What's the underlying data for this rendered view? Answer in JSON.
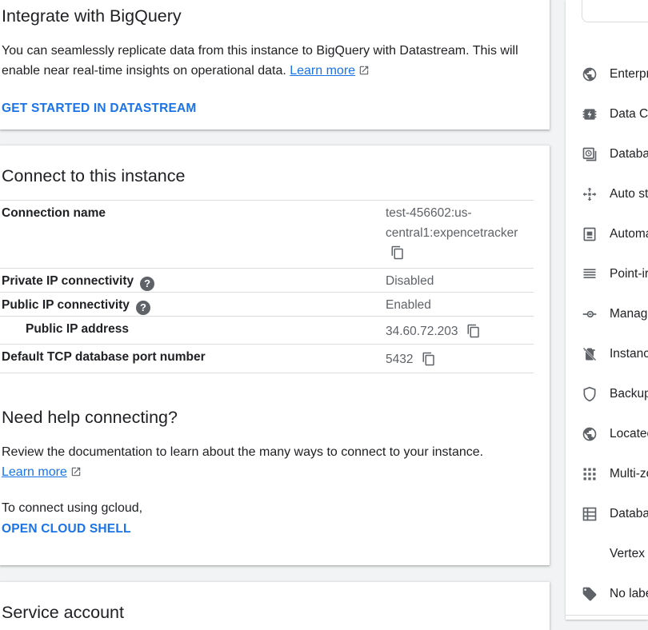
{
  "bigquery": {
    "title": "Integrate with BigQuery",
    "description": "You can seamlessly replicate data from this instance to BigQuery with Datastream. This will enable near real-time insights on operational data.",
    "learn_more": "Learn more",
    "action": "GET STARTED IN DATASTREAM"
  },
  "connect": {
    "title": "Connect to this instance",
    "rows": [
      {
        "label": "Connection name",
        "value_line1": "test-456602:us-",
        "value_line2": "central1:expencetracker"
      },
      {
        "label": "Private IP connectivity",
        "value": "Disabled"
      },
      {
        "label": "Public IP connectivity",
        "value": "Enabled"
      },
      {
        "label": "Public IP address",
        "value": "34.60.72.203"
      },
      {
        "label": "Default TCP database port number",
        "value": "5432"
      }
    ],
    "help_title": "Need help connecting?",
    "help_text": "Review the documentation to learn about the many ways to connect to your instance.",
    "learn_more": "Learn more",
    "gcloud_text": "To connect using gcloud,",
    "shell_action": "OPEN CLOUD SHELL"
  },
  "service_account": {
    "title": "Service account"
  },
  "sidebar": {
    "items": [
      {
        "label": "Enterpr",
        "icon": "globe-icon"
      },
      {
        "label": "Data Ca",
        "icon": "data-cache-icon"
      },
      {
        "label": "Databa",
        "icon": "database-time-icon"
      },
      {
        "label": "Auto st",
        "icon": "expand-arrows-icon"
      },
      {
        "label": "Automa",
        "icon": "backup-icon"
      },
      {
        "label": "Point-ir",
        "icon": "lines-icon"
      },
      {
        "label": "Manage",
        "icon": "commit-icon"
      },
      {
        "label": "Instanc",
        "icon": "delete-off-icon"
      },
      {
        "label": "Backup",
        "icon": "shield-icon"
      },
      {
        "label": "Locatec",
        "icon": "globe-icon"
      },
      {
        "label": "Multi-zo",
        "icon": "grid-dots-icon"
      },
      {
        "label": "Databa",
        "icon": "table-icon"
      },
      {
        "label": "Vertex ,",
        "icon": ""
      },
      {
        "label": "No labe",
        "icon": "tag-icon"
      }
    ]
  },
  "colors": {
    "accent": "#1a73e8",
    "text": "#202124",
    "secondary_text": "#5f6368",
    "background": "#f1f3f4"
  }
}
